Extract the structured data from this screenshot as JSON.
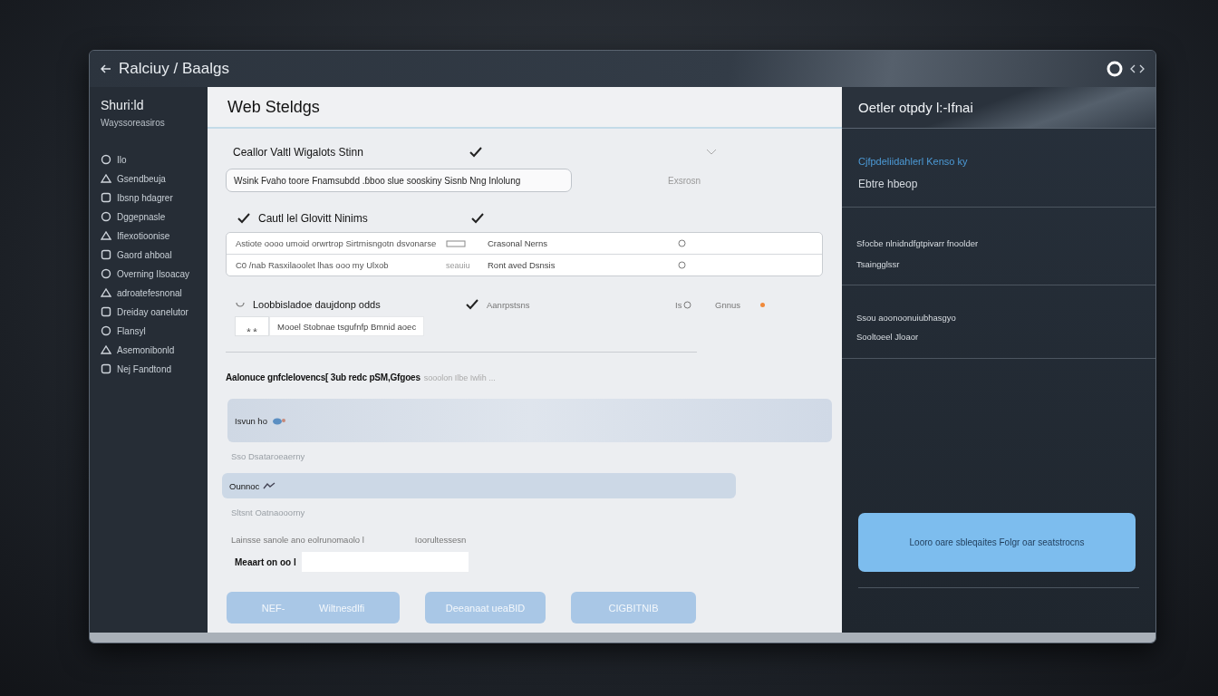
{
  "window": {
    "title": "Ralciuy / Baalgs"
  },
  "sidebar": {
    "title": "Shuri:ld",
    "subtitle": "Wayssoreasiros",
    "items": [
      {
        "label": "Ilo"
      },
      {
        "label": "Gsendbeuja"
      },
      {
        "label": "Ibsnp hdagrer"
      },
      {
        "label": "Dggepnasle"
      },
      {
        "label": "Ifiexotioonise"
      },
      {
        "label": "Gaord ahboal"
      },
      {
        "label": "Overning Ilsoacay"
      },
      {
        "label": "adroatefesnonal"
      },
      {
        "label": "Dreiday oanelutor"
      },
      {
        "label": "Flansyl"
      },
      {
        "label": "Asemonibonld"
      },
      {
        "label": "Nej Fandtond"
      }
    ]
  },
  "main": {
    "title": "Web Steldgs",
    "section_1": {
      "label": "Ceallor Valtl Wigalots Stinn",
      "checked": true,
      "field_value": "Wsink Fvaho toore  Fnamsubdd .ɓboo slue sooskiny  Sisnb Nng Inlolung",
      "side_text": "Exsrosn"
    },
    "section_2": {
      "lead_checked": true,
      "label": "Cautl lel Glovitt Ninims",
      "checked": true,
      "rows": [
        {
          "column_1": "Astiote oooo umoid orwrtrop Sirtrnisngotn dsvonarse",
          "column_3": "Crasonal Nerns"
        },
        {
          "column_1": "C0 /nab Rasxilaoolet lhas ooo my Ulxob",
          "column_2": "seauiu",
          "column_3": "Ront aved  Dsnsis"
        }
      ]
    },
    "section_3": {
      "label": "Loobbisladoe daujdonp odds",
      "checked": true,
      "note": "Aanrpstsns",
      "count": "Is",
      "status": "Gnnus",
      "stepper": "⁎ ⁎",
      "field_value": "Mooel Stobnae tsgufnfp Bmnid  aoec"
    },
    "advanced": {
      "text": "Aalonuce gnfclelovencs[ 3ub redc pSM,Gfgoes",
      "hint": "sooolon Ilbe Iwlih ..."
    },
    "options": [
      {
        "kind": "banner",
        "label": "Isvun ho"
      },
      {
        "kind": "note",
        "label": "Sso Dsataroeaerny"
      },
      {
        "kind": "highlight",
        "label": "Ounnoc"
      },
      {
        "kind": "note",
        "label": "Sltsnt Oatnaooorny"
      }
    ],
    "pair": [
      "Lainsse sanole ano eolrunomaolo l",
      "Ioorultessesn"
    ],
    "input_label": "Meaart on oo l",
    "buttons": [
      {
        "labels": [
          "NEF-",
          "Wiltnesdlfi"
        ]
      },
      {
        "labels": [
          "Deeanaat ueaBID"
        ]
      },
      {
        "labels": [
          "CIGBITNIB"
        ]
      }
    ]
  },
  "detail": {
    "title": "Oetler otpdy l:-Ifnai",
    "groups": [
      {
        "lines": [
          {
            "kind": "link",
            "text": "Cjfpdeliidahlerl Kenso ky"
          },
          {
            "kind": "text",
            "text": "Ebtre hbeop"
          }
        ]
      },
      {
        "lines": [
          {
            "kind": "small",
            "text": "Sfocbe nlnidndfgtpivarr fnoolder"
          },
          {
            "kind": "small",
            "text": "Tsaingglssr"
          }
        ]
      },
      {
        "lines": [
          {
            "kind": "small",
            "text": "Ssou aoonoonuiubhasgyo"
          },
          {
            "kind": "small",
            "text": "Sooltoeel Jloaor"
          }
        ]
      }
    ],
    "action": "Looro oare sbleqaites Folgr oar seatstrocns"
  }
}
